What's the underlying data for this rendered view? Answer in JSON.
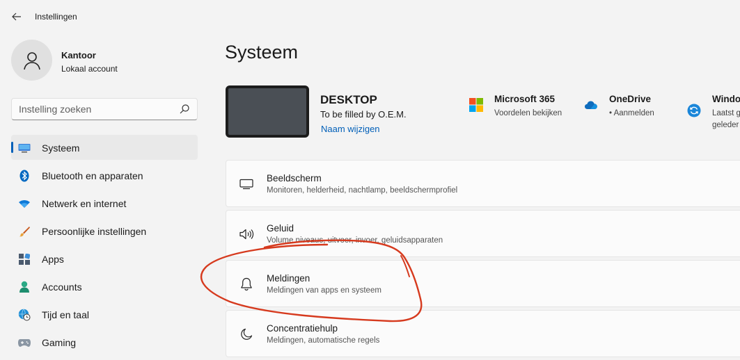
{
  "app": {
    "title": "Instellingen"
  },
  "profile": {
    "name": "Kantoor",
    "account_type": "Lokaal account"
  },
  "search": {
    "placeholder": "Instelling zoeken"
  },
  "sidebar": {
    "items": [
      {
        "label": "Systeem",
        "icon": "monitor-icon",
        "active": true
      },
      {
        "label": "Bluetooth en apparaten",
        "icon": "bluetooth-icon"
      },
      {
        "label": "Netwerk en internet",
        "icon": "wifi-icon"
      },
      {
        "label": "Persoonlijke instellingen",
        "icon": "brush-icon"
      },
      {
        "label": "Apps",
        "icon": "apps-icon"
      },
      {
        "label": "Accounts",
        "icon": "person-icon"
      },
      {
        "label": "Tijd en taal",
        "icon": "globe-clock-icon"
      },
      {
        "label": "Gaming",
        "icon": "gamepad-icon"
      }
    ]
  },
  "main": {
    "title": "Systeem",
    "device": {
      "name": "DESKTOP",
      "model": "To be filled by O.E.M.",
      "rename_link": "Naam wijzigen"
    },
    "quick_links": [
      {
        "title": "Microsoft 365",
        "subtitle": "Voordelen bekijken",
        "icon": "microsoft-logo-icon"
      },
      {
        "title": "OneDrive",
        "subtitle": "• Aanmelden",
        "icon": "cloud-icon"
      },
      {
        "title": "Windo",
        "subtitle": "Laatst g",
        "subtitle2": "geleder",
        "icon": "update-icon"
      }
    ],
    "cards": [
      {
        "title": "Beeldscherm",
        "description": "Monitoren, helderheid, nachtlamp, beeldschermprofiel",
        "icon": "display-icon"
      },
      {
        "title": "Geluid",
        "description": "Volume niveaus, uitvoer, invoer, geluidsapparaten",
        "icon": "speaker-icon"
      },
      {
        "title": "Meldingen",
        "description": "Meldingen van apps en systeem",
        "icon": "bell-icon"
      },
      {
        "title": "Concentratiehulp",
        "description": "Meldingen, automatische regels",
        "icon": "moon-icon"
      }
    ]
  },
  "colors": {
    "accent": "#005fb8",
    "annotation": "#d63a1e",
    "background": "#f3f3f3"
  }
}
